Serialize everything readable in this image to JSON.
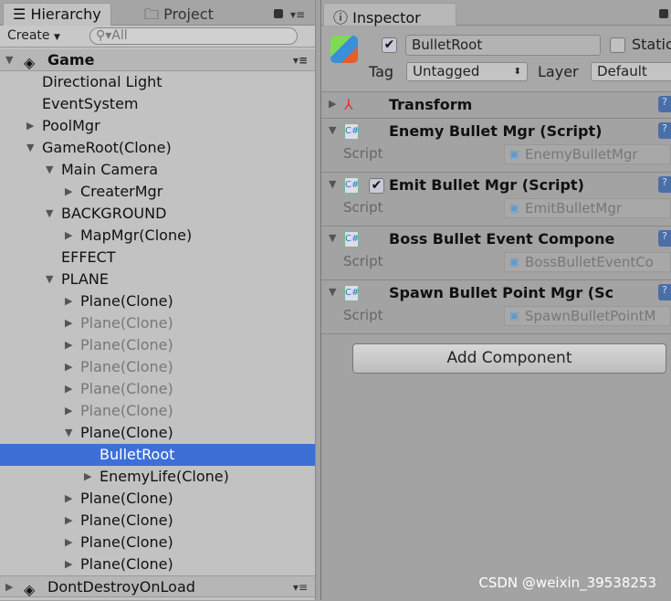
{
  "hierarchy": {
    "tab_label": "Hierarchy",
    "project_tab_label": "Project",
    "create_label": "Create",
    "search_placeholder": "All",
    "scene": "Game",
    "items": [
      {
        "label": "Directional Light",
        "depth": 0,
        "arrow": "",
        "state": ""
      },
      {
        "label": "EventSystem",
        "depth": 0,
        "arrow": "",
        "state": ""
      },
      {
        "label": "PoolMgr",
        "depth": 0,
        "arrow": "collapsed",
        "state": ""
      },
      {
        "label": "GameRoot(Clone)",
        "depth": 0,
        "arrow": "expanded",
        "state": ""
      },
      {
        "label": "Main Camera",
        "depth": 1,
        "arrow": "expanded",
        "state": ""
      },
      {
        "label": "CreaterMgr",
        "depth": 2,
        "arrow": "collapsed",
        "state": ""
      },
      {
        "label": "BACKGROUND",
        "depth": 1,
        "arrow": "expanded",
        "state": ""
      },
      {
        "label": "MapMgr(Clone)",
        "depth": 2,
        "arrow": "collapsed",
        "state": ""
      },
      {
        "label": "EFFECT",
        "depth": 1,
        "arrow": "",
        "state": ""
      },
      {
        "label": "PLANE",
        "depth": 1,
        "arrow": "expanded",
        "state": ""
      },
      {
        "label": "Plane(Clone)",
        "depth": 2,
        "arrow": "collapsed",
        "state": ""
      },
      {
        "label": "Plane(Clone)",
        "depth": 2,
        "arrow": "collapsed",
        "state": "inactive"
      },
      {
        "label": "Plane(Clone)",
        "depth": 2,
        "arrow": "collapsed",
        "state": "inactive"
      },
      {
        "label": "Plane(Clone)",
        "depth": 2,
        "arrow": "collapsed",
        "state": "inactive"
      },
      {
        "label": "Plane(Clone)",
        "depth": 2,
        "arrow": "collapsed",
        "state": "inactive"
      },
      {
        "label": "Plane(Clone)",
        "depth": 2,
        "arrow": "collapsed",
        "state": "inactive"
      },
      {
        "label": "Plane(Clone)",
        "depth": 2,
        "arrow": "expanded",
        "state": ""
      },
      {
        "label": "BulletRoot",
        "depth": 3,
        "arrow": "",
        "state": "selected"
      },
      {
        "label": "EnemyLife(Clone)",
        "depth": 3,
        "arrow": "collapsed",
        "state": ""
      },
      {
        "label": "Plane(Clone)",
        "depth": 2,
        "arrow": "collapsed",
        "state": ""
      },
      {
        "label": "Plane(Clone)",
        "depth": 2,
        "arrow": "collapsed",
        "state": ""
      },
      {
        "label": "Plane(Clone)",
        "depth": 2,
        "arrow": "collapsed",
        "state": ""
      },
      {
        "label": "Plane(Clone)",
        "depth": 2,
        "arrow": "collapsed",
        "state": ""
      }
    ],
    "scene2": "DontDestroyOnLoad"
  },
  "inspector": {
    "tab_label": "Inspector",
    "object_name": "BulletRoot",
    "active": true,
    "static_label": "Static",
    "tag_label": "Tag",
    "tag_value": "Untagged",
    "layer_label": "Layer",
    "layer_value": "Default",
    "transform": "Transform",
    "components": [
      {
        "title": "Enemy Bullet Mgr (Script)",
        "checkbox": false,
        "script_label": "Script",
        "script": "EnemyBulletMgr"
      },
      {
        "title": "Emit Bullet Mgr (Script)",
        "checkbox": true,
        "script_label": "Script",
        "script": "EmitBulletMgr"
      },
      {
        "title": "Boss Bullet Event Compone",
        "checkbox": false,
        "script_label": "Script",
        "script": "BossBulletEventCo"
      },
      {
        "title": "Spawn Bullet Point Mgr (Sc",
        "checkbox": false,
        "script_label": "Script",
        "script": "SpawnBulletPointM"
      }
    ],
    "add_component": "Add Component"
  },
  "watermark": "CSDN @weixin_39538253",
  "colors": {
    "selection": "#3d6fd6",
    "panel": "#c2c2c2"
  }
}
